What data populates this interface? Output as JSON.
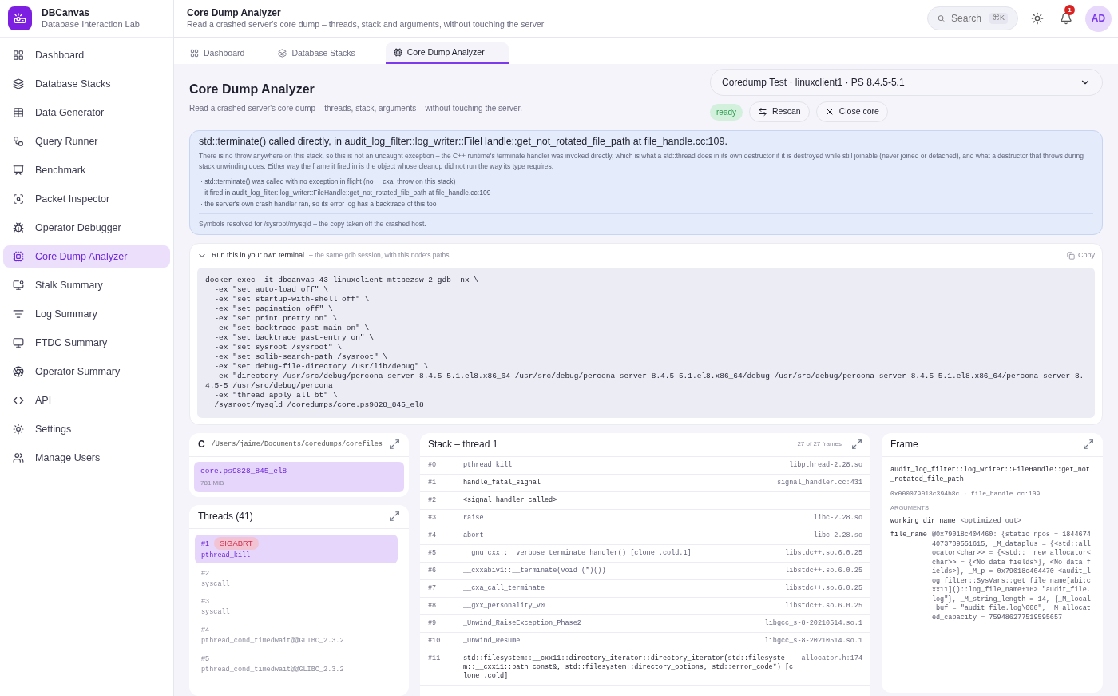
{
  "brand": {
    "name": "DBCanvas",
    "subtitle": "Database Interaction Lab"
  },
  "sidebar": {
    "items": [
      {
        "label": "Dashboard",
        "selected": false
      },
      {
        "label": "Database Stacks",
        "selected": false
      },
      {
        "label": "Data Generator",
        "selected": false
      },
      {
        "label": "Query Runner",
        "selected": false
      },
      {
        "label": "Benchmark",
        "selected": false
      },
      {
        "label": "Packet Inspector",
        "selected": false
      },
      {
        "label": "Operator Debugger",
        "selected": false
      },
      {
        "label": "Core Dump Analyzer",
        "selected": true
      },
      {
        "label": "Stalk Summary",
        "selected": false
      },
      {
        "label": "Log Summary",
        "selected": false
      },
      {
        "label": "FTDC Summary",
        "selected": false
      },
      {
        "label": "Operator Summary",
        "selected": false
      },
      {
        "label": "API",
        "selected": false
      },
      {
        "label": "Settings",
        "selected": false
      },
      {
        "label": "Manage Users",
        "selected": false
      }
    ]
  },
  "header": {
    "title": "Core Dump Analyzer",
    "subtitle": "Read a crashed server's core dump – threads, stack and arguments, without touching the server",
    "search": {
      "placeholder": "Search",
      "shortcut": "⌘K"
    },
    "notifications": "1",
    "avatar": "AD"
  },
  "tabs": [
    {
      "label": "Dashboard",
      "selected": false
    },
    {
      "label": "Database Stacks",
      "selected": false
    },
    {
      "label": "Core Dump Analyzer",
      "selected": true
    }
  ],
  "page": {
    "title": "Core Dump Analyzer",
    "subtitle": "Read a crashed server's core dump – threads, stack, arguments – without touching the server.",
    "target": "Coredump Test · linuxclient1 · PS 8.4.5-5.1",
    "status": "ready",
    "actions": [
      "Rescan",
      "Close core"
    ]
  },
  "summary": {
    "headline": "std::terminate() called directly, in audit_log_filter::log_writer::FileHandle::get_not_rotated_file_path at file_handle.cc:109.",
    "body": "There is no throw anywhere on this stack, so this is not an uncaught exception – the C++ runtime's terminate handler was invoked directly, which is what a std::thread does in its own destructor if it is destroyed while still joinable (never joined or detached), and what a destructor that throws during stack unwinding does. Either way the frame it fired in is the object whose cleanup did not run the way its type requires.",
    "points": [
      "· std::terminate() was called with no exception in flight (no __cxa_throw on this stack)",
      "· it fired in audit_log_filter::log_writer::FileHandle::get_not_rotated_file_path at file_handle.cc:109",
      "· the server's own crash handler ran, so its error log has a backtrace of this too"
    ],
    "footer": "Symbols resolved for /sysroot/mysqld – the copy taken off the crashed host."
  },
  "terminal": {
    "expanded": true,
    "title": "Run this in your own terminal",
    "note": "– the same gdb session, with this node's paths",
    "copy": "Copy",
    "lines": [
      "docker exec -it dbcanvas-43-linuxclient-mttbezsw-2 gdb -nx \\",
      "  -ex \"set auto-load off\" \\",
      "  -ex \"set startup-with-shell off\" \\",
      "  -ex \"set pagination off\" \\",
      "  -ex \"set print pretty on\" \\",
      "  -ex \"set backtrace past-main on\" \\",
      "  -ex \"set backtrace past-entry on\" \\",
      "  -ex \"set sysroot /sysroot\" \\",
      "  -ex \"set solib-search-path /sysroot\" \\",
      "  -ex \"set debug-file-directory /usr/lib/debug\" \\",
      "  -ex \"directory /usr/src/debug/percona-server-8.4.5-5.1.el8.x86_64 /usr/src/debug/percona-server-8.4.5-5.1.el8.x86_64/debug /usr/src/debug/percona-server-8.4.5-5.1.el8.x86_64/percona-server-8.4.5-5 /usr/src/debug/percona",
      "  -ex \"thread apply all bt\" \\",
      "  /sysroot/mysqld /coredumps/core.ps9828_845_el8"
    ]
  },
  "files": {
    "drive": "C",
    "path": "/Users/jaime/Documents/coredumps/corefiles",
    "items": [
      {
        "name": "core.ps9828_845_el8",
        "size": "781 MiB",
        "selected": true
      }
    ]
  },
  "threads": {
    "title": "Threads (41)",
    "items": [
      {
        "id": "#1",
        "signal": "SIGABRT",
        "fn": "pthread_kill",
        "selected": true
      },
      {
        "id": "#2",
        "fn": "syscall",
        "selected": false
      },
      {
        "id": "#3",
        "fn": "syscall",
        "selected": false
      },
      {
        "id": "#4",
        "fn": "pthread_cond_timedwait@@GLIBC_2.3.2",
        "selected": false
      },
      {
        "id": "#5",
        "fn": "pthread_cond_timedwait@@GLIBC_2.3.2",
        "selected": false
      }
    ]
  },
  "stack": {
    "title": "Stack – thread 1",
    "count": "27 of 27 frames",
    "frames": [
      {
        "n": "#0",
        "fn": "pthread_kill",
        "where": "libpthread-2.28.so",
        "own": false
      },
      {
        "n": "#1",
        "fn": "handle_fatal_signal",
        "where": "signal_handler.cc:431",
        "own": true
      },
      {
        "n": "#2",
        "fn": "<signal handler called>",
        "own": true
      },
      {
        "n": "#3",
        "fn": "raise",
        "where": "libc-2.28.so",
        "own": false
      },
      {
        "n": "#4",
        "fn": "abort",
        "where": "libc-2.28.so",
        "own": false
      },
      {
        "n": "#5",
        "fn": "__gnu_cxx::__verbose_terminate_handler() [clone .cold.1]",
        "where": "libstdc++.so.6.0.25",
        "own": false
      },
      {
        "n": "#6",
        "fn": "__cxxabiv1::__terminate(void (*)())",
        "where": "libstdc++.so.6.0.25",
        "own": false
      },
      {
        "n": "#7",
        "fn": "__cxa_call_terminate",
        "where": "libstdc++.so.6.0.25",
        "own": false
      },
      {
        "n": "#8",
        "fn": "__gxx_personality_v0",
        "where": "libstdc++.so.6.0.25",
        "own": false
      },
      {
        "n": "#9",
        "fn": "_Unwind_RaiseException_Phase2",
        "where": "libgcc_s-8-20210514.so.1",
        "own": false
      },
      {
        "n": "#10",
        "fn": "_Unwind_Resume",
        "where": "libgcc_s-8-20210514.so.1",
        "own": false
      },
      {
        "n": "#11",
        "fn": "std::filesystem::__cxx11::directory_iterator::directory_iterator(std::filesystem::__cxx11::path const&, std::filesystem::directory_options, std::error_code*) [clone .cold]",
        "where": "allocator.h:174",
        "own": true
      }
    ]
  },
  "frame": {
    "title": "Frame",
    "function": "audit_log_filter::log_writer::FileHandle::get_not_rotated_file_path",
    "location": "0x000079018c394b8c · file_handle.cc:109",
    "arguments_label": "ARGUMENTS",
    "arguments": [
      {
        "name": "working_dir_name",
        "value": "<optimized out>"
      },
      {
        "name": "file_name",
        "value": "@0x79018c404460: {static npos = 18446744073709551615, _M_dataplus = {<std::allocator<char>> = {<std::__new_allocator<char>> = {<No data fields>}, <No data fields>}, _M_p = 0x79018c404470 <audit_log_filter::SysVars::get_file_name[abi:cxx11]()::log_file_name+16> \"audit_file.log\"}, _M_string_length = 14, {_M_local_buf = \"audit_file.log\\000\", _M_allocated_capacity = 759486277519595657"
      }
    ]
  }
}
